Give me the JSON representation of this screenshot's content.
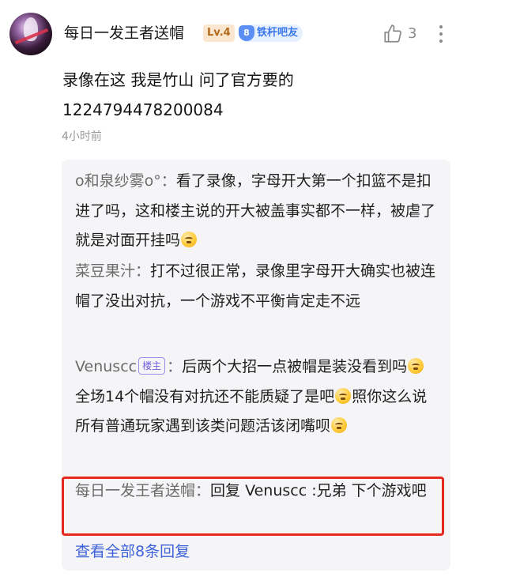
{
  "comment": {
    "username": "每日一发王者送帽",
    "level": "Lv.4",
    "fan_badge_number": "8",
    "fan_badge_label": "铁杆吧友",
    "like_count": "3",
    "text_line1": "录像在这 我是竹山 问了官方要的",
    "text_line2": "1224794478200084",
    "time": "4小时前"
  },
  "replies": [
    {
      "author": "o和泉纱雾o°",
      "sep": "：",
      "text": "看了录像，字母开大第一个扣篮不是扣进了吗，这和楼主说的开大被盖事实都不一样，被虐了就是对面开挂吗"
    },
    {
      "author": "菜豆果汁",
      "sep": "：",
      "text": "打不过很正常，录像里字母开大确实也被连帽了没出对抗，一个游戏不平衡肯定走不远"
    },
    {
      "author": "Venuscc",
      "tag": "楼主",
      "sep": "：",
      "text_a": "后两个大招一点被帽是装没看到吗",
      "text_b": "全场14个帽没有对抗还不能质疑了是吧",
      "text_c": "照你这么说所有普通玩家遇到该类问题活该闭嘴呗"
    },
    {
      "author": "每日一发王者送帽",
      "sep": "：",
      "text": "回复 Venuscc :兄弟 下个游戏吧"
    }
  ],
  "view_all": "查看全部8条回复",
  "icons": {
    "like": "thumbs-up-icon",
    "more": "more-vertical-icon",
    "emoji": "sweat-smile-emoji-icon"
  },
  "colors": {
    "accent_link": "#3f62d8",
    "highlight_border": "#e8271f",
    "op_tag": "#6f5ee0"
  }
}
